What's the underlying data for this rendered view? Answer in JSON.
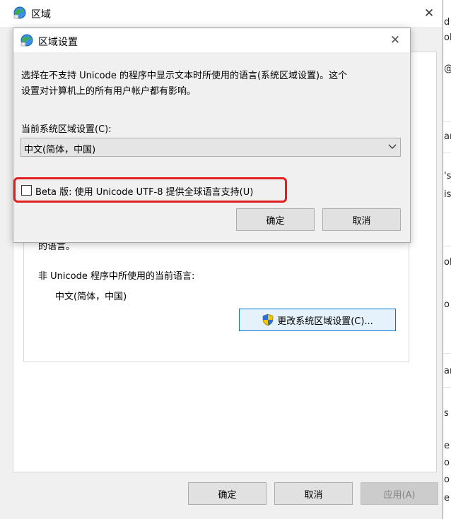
{
  "outer_window": {
    "title": "区域",
    "close_symbol": "✕",
    "partial_text": "的语言。",
    "nonunicode_label": "非 Unicode 程序中所使用的当前语言:",
    "nonunicode_value": "中文(简体，中国)",
    "change_locale_button": "更改系统区域设置(C)...",
    "ok_button": "确定",
    "cancel_button": "取消",
    "apply_button": "应用(A)"
  },
  "dialog": {
    "title": "区域设置",
    "close_symbol": "✕",
    "description_line1": "选择在不支持 Unicode 的程序中显示文本时所使用的语言(系统区域设置)。这个",
    "description_line2": "设置对计算机上的所有用户帐户都有影响。",
    "current_locale_label": "当前系统区域设置(C):",
    "current_locale_value": "中文(简体，中国)",
    "beta_checkbox_label": "Beta 版: 使用 Unicode UTF-8 提供全球语言支持(U)",
    "beta_checked": false,
    "ok_button": "确定",
    "cancel_button": "取消"
  },
  "background_strip": [
    "d",
    "oh",
    "@",
    "ar",
    "'s",
    "is",
    "oh",
    "o",
    "ar",
    "s",
    "e",
    "o",
    "o",
    "e"
  ],
  "icons": {
    "globe": "globe-icon",
    "shield": "uac-shield-icon",
    "chevron": "chevron-down-icon"
  },
  "colors": {
    "highlight": "#e02020",
    "focus_border": "#0078d7",
    "dialog_bg": "#f0f0f0"
  }
}
